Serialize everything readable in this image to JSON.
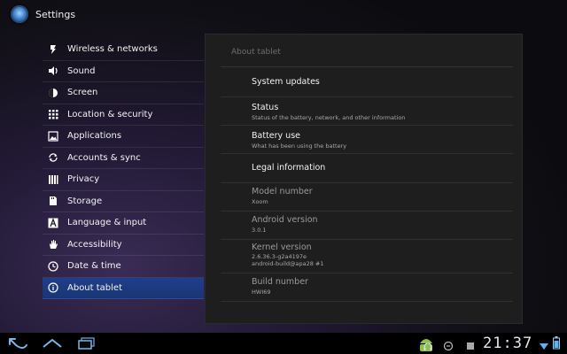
{
  "app": {
    "title": "Settings",
    "icon": "settings-app-icon"
  },
  "sidebar": {
    "selected_index": 10,
    "items": [
      {
        "label": "Wireless & networks",
        "icon": "wireless-icon"
      },
      {
        "label": "Sound",
        "icon": "sound-icon"
      },
      {
        "label": "Screen",
        "icon": "screen-brightness-icon"
      },
      {
        "label": "Location & security",
        "icon": "location-grid-icon"
      },
      {
        "label": "Applications",
        "icon": "applications-icon"
      },
      {
        "label": "Accounts & sync",
        "icon": "sync-icon"
      },
      {
        "label": "Privacy",
        "icon": "privacy-icon"
      },
      {
        "label": "Storage",
        "icon": "storage-icon"
      },
      {
        "label": "Language & input",
        "icon": "language-icon"
      },
      {
        "label": "Accessibility",
        "icon": "accessibility-hand-icon"
      },
      {
        "label": "Date & time",
        "icon": "clock-icon"
      },
      {
        "label": "About tablet",
        "icon": "info-icon"
      }
    ]
  },
  "panel": {
    "title": "About tablet",
    "rows": [
      {
        "title": "System updates",
        "subtitle": []
      },
      {
        "title": "Status",
        "subtitle": [
          "Status of the battery, network, and other information"
        ]
      },
      {
        "title": "Battery use",
        "subtitle": [
          "What has been using the battery"
        ]
      },
      {
        "title": "Legal information",
        "subtitle": []
      },
      {
        "title": "Model number",
        "subtitle": [
          "Xoom"
        ]
      },
      {
        "title": "Android version",
        "subtitle": [
          "3.0.1"
        ]
      },
      {
        "title": "Kernel version",
        "subtitle": [
          "2.6.36.3-g2a4197e",
          "android-build@apa28 #1"
        ]
      },
      {
        "title": "Build number",
        "subtitle": [
          "HWI69"
        ]
      }
    ]
  },
  "system_bar": {
    "clock": "21:37",
    "buttons": [
      "back-icon",
      "home-icon",
      "recent-apps-icon"
    ],
    "status_icons": [
      "android-icon",
      "headset-icon",
      "usb-icon",
      "signal-icon",
      "wifi-icon",
      "battery-icon"
    ],
    "accent": "#1f3f8a"
  }
}
